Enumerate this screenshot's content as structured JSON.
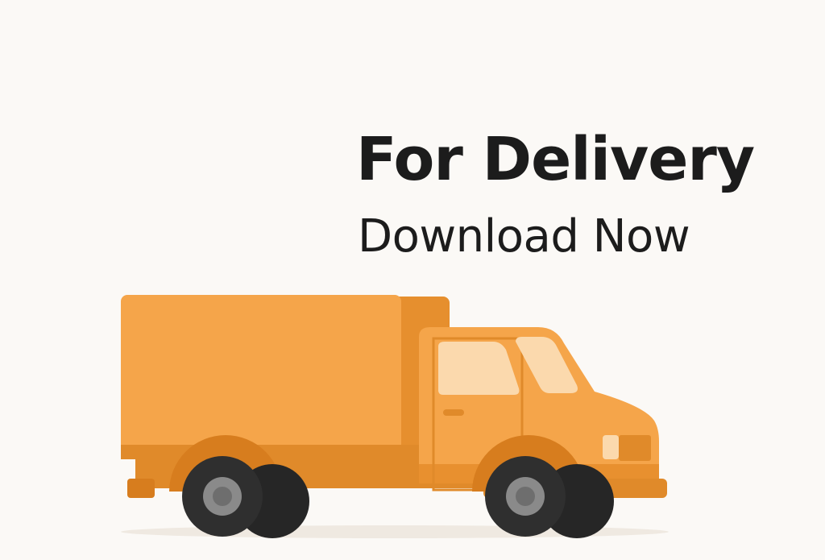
{
  "banner": {
    "headline": "For Delivery",
    "subline": "Download Now"
  },
  "illustration": {
    "icon": "delivery-truck-icon",
    "colors": {
      "body": "#f5a54a",
      "shade": "#e88f2c",
      "dark_shade": "#d77d1e",
      "window": "#fbd9ad",
      "tire": "#2f2f2f",
      "hubcap": "#8a8a8a"
    }
  }
}
